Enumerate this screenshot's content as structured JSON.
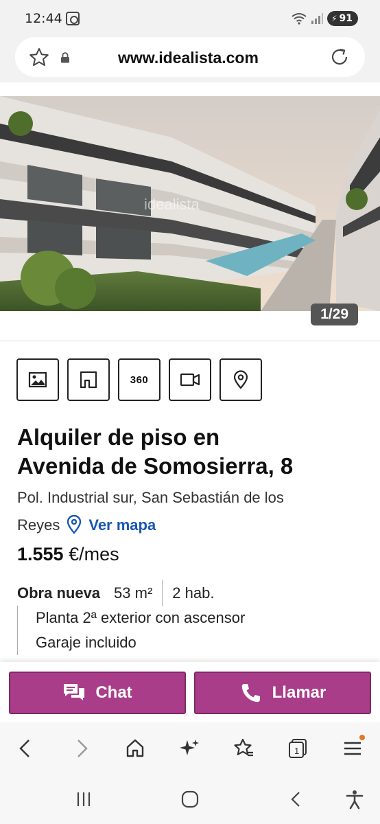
{
  "status": {
    "time": "12:44",
    "battery": "91"
  },
  "browser": {
    "url": "www.idealista.com"
  },
  "gallery": {
    "counter": "1/29",
    "watermark": "idealista"
  },
  "media_buttons": [
    {
      "icon": "photo-icon"
    },
    {
      "icon": "floorplan-icon"
    },
    {
      "icon": "360-icon",
      "label": "360"
    },
    {
      "icon": "video-icon"
    },
    {
      "icon": "map-pin-icon"
    }
  ],
  "listing": {
    "title_line1": "Alquiler de piso en",
    "title_line2": "Avenida de Somosierra, 8",
    "location_line1": "Pol. Industrial sur, San Sebastián de los",
    "location_line2": "Reyes",
    "map_link": "Ver mapa",
    "price_amount": "1.555",
    "price_unit": "€/mes",
    "obra": "Obra nueva",
    "area": "53 m²",
    "rooms": "2 hab.",
    "detail1": "Planta 2ª exterior con ascensor",
    "detail2": "Garaje incluido"
  },
  "contact": {
    "chat_label": "Chat",
    "call_label": "Llamar",
    "accent_color": "#a93d8a"
  },
  "browser_nav": [
    "back-icon",
    "forward-icon",
    "home-icon",
    "sparkle-icon",
    "bookmarks-icon",
    "tabs-icon",
    "menu-icon"
  ],
  "tabs_count": "1"
}
